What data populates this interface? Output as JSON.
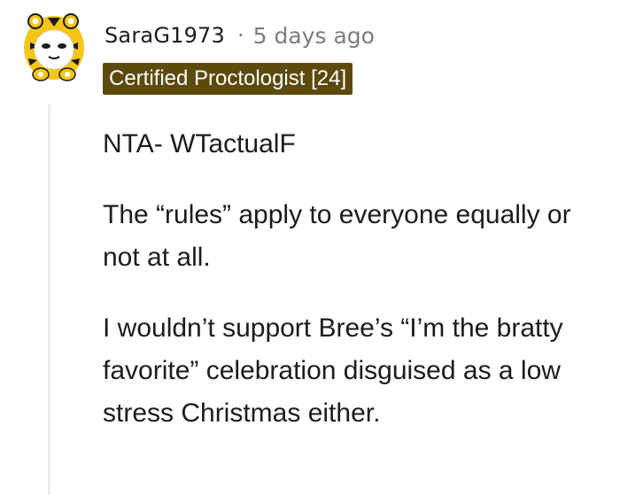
{
  "comment": {
    "username": "SaraG1973",
    "separator": "·",
    "timestamp": "5 days ago",
    "flair": "Certified Proctologist [24]",
    "paragraphs": [
      "NTA- WTactualF",
      "The “rules” apply to everyone equally or not at all.",
      "I wouldn’t support Bree’s “I’m the bratty favorite” celebration disguised as a low stress Christmas either."
    ]
  },
  "colors": {
    "flair_background": "#5c4a0c",
    "flair_text": "#ffffff",
    "meta_text": "#7c7c7c",
    "body_text": "#1c1c1c",
    "avatar_yellow": "#f5c518",
    "thread_line": "#ededed"
  },
  "icons": {
    "avatar": "tiger-costume-snoo-avatar-icon"
  }
}
